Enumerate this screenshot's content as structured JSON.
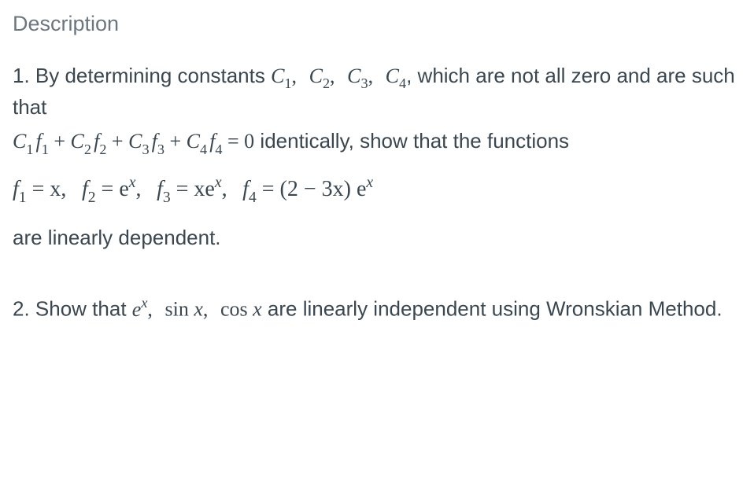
{
  "heading": "Description",
  "problem1": {
    "intro_pre": "1. By determining constants ",
    "c1": "C",
    "c2": "C",
    "c3": "C",
    "c4": "C",
    "s1": "1",
    "s2": "2",
    "s3": "3",
    "s4": "4",
    "comma": ", ",
    "intro_mid": ", which are not all zero and are such that",
    "eq_C1": "C",
    "eq_s1": "1",
    "eq_f1": "f",
    "eq_fs1": "1",
    "eq_plus": " + ",
    "eq_C2": "C",
    "eq_s2": "2",
    "eq_f2": "f",
    "eq_fs2": "2",
    "eq_C3": "C",
    "eq_s3": "3",
    "eq_f3": "f",
    "eq_fs3": "3",
    "eq_C4": "C",
    "eq_s4": "4",
    "eq_f4": "f",
    "eq_fs4": "4",
    "eq_zero": " = 0",
    "eq_tail": " identically, show that the functions",
    "fn_f": "f",
    "fn_1": "1",
    "fn_eqx": " = x,",
    "fn_2": "2",
    "fn_eqe": " = e",
    "fn_x": "x",
    "fn_c": ",",
    "fn_3": "3",
    "fn_eqxe": " = xe",
    "fn_4": "4",
    "fn_eq23x": " = (2 − 3x) e",
    "tail": "are linearly dependent."
  },
  "problem2": {
    "pre": "2. Show that ",
    "e": "e",
    "x": "x",
    "comma": ", ",
    "sin": "sin ",
    "xv": "x",
    "cos": "cos ",
    "tail": " are linearly independent using Wronskian Method."
  }
}
